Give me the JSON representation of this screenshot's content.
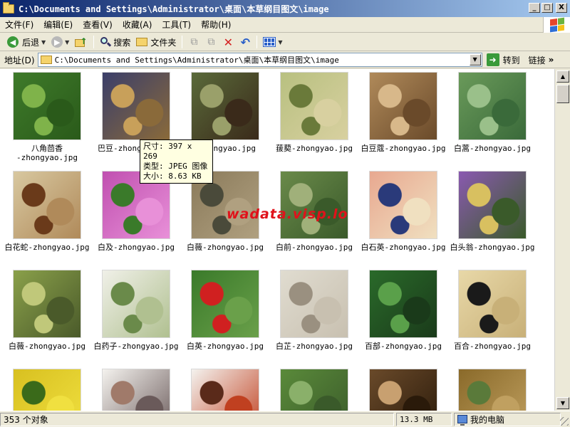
{
  "window": {
    "title": "C:\\Documents and Settings\\Administrator\\桌面\\本草纲目图文\\image",
    "buttons": {
      "minimize": "_",
      "maximize": "□",
      "close": "X"
    }
  },
  "menu": [
    "文件(F)",
    "编辑(E)",
    "查看(V)",
    "收藏(A)",
    "工具(T)",
    "帮助(H)"
  ],
  "toolbar": {
    "back": "后退",
    "search": "搜索",
    "folders": "文件夹"
  },
  "address": {
    "label": "地址(D)",
    "path": "C:\\Documents and Settings\\Administrator\\桌面\\本草纲目图文\\image",
    "go": "转到",
    "links": "链接"
  },
  "files": [
    {
      "name": "八角茴香\n-zhongyao.jpg",
      "colors": [
        "#3e7a2a",
        "#7fb34a",
        "#2a5a1a"
      ]
    },
    {
      "name": "巴豆-zhongyao.jpg",
      "colors": [
        "#3a3e6a",
        "#c8a05a",
        "#8a6a3a"
      ]
    },
    {
      "name": "-zhongyao.jpg",
      "colors": [
        "#5a6a3a",
        "#9aa06a",
        "#3a2a1a"
      ]
    },
    {
      "name": "菝葜-zhongyao.jpg",
      "colors": [
        "#b8c080",
        "#6a7a3a",
        "#d8d0a0"
      ]
    },
    {
      "name": "白豆蔻-zhongyao.jpg",
      "colors": [
        "#b08a5a",
        "#d8b88a",
        "#6a4a2a"
      ]
    },
    {
      "name": "白蒿-zhongyao.jpg",
      "colors": [
        "#6a9a5a",
        "#9ac08a",
        "#3a6a3a"
      ]
    },
    {
      "name": "白花蛇-zhongyao.jpg",
      "colors": [
        "#d8c8a0",
        "#6a3a1a",
        "#b08a5a"
      ]
    },
    {
      "name": "白及-zhongyao.jpg",
      "colors": [
        "#c050b0",
        "#3a7a2a",
        "#e890d8"
      ]
    },
    {
      "name": "白薇-zhongyao.jpg",
      "colors": [
        "#8a7a5a",
        "#4a4a3a",
        "#b0a080"
      ]
    },
    {
      "name": "白前-zhongyao.jpg",
      "colors": [
        "#6a8a4a",
        "#a0b07a",
        "#3a5a2a"
      ]
    },
    {
      "name": "白石英-zhongyao.jpg",
      "colors": [
        "#e8a890",
        "#2a3a7a",
        "#f0e0c0"
      ]
    },
    {
      "name": "白头翁-zhongyao.jpg",
      "colors": [
        "#8a5ab0",
        "#d8c060",
        "#3a5a2a"
      ]
    },
    {
      "name": "白薇-zhongyao.jpg",
      "colors": [
        "#8aa04a",
        "#c0c87a",
        "#4a5a2a"
      ]
    },
    {
      "name": "白药子-zhongyao.jpg",
      "colors": [
        "#f0f0e8",
        "#6a8a4a",
        "#b0c090"
      ]
    },
    {
      "name": "白英-zhongyao.jpg",
      "colors": [
        "#3a7a2a",
        "#d02020",
        "#6aa04a"
      ]
    },
    {
      "name": "白芷-zhongyao.jpg",
      "colors": [
        "#e0dcd0",
        "#9a9080",
        "#c8c0b0"
      ]
    },
    {
      "name": "百部-zhongyao.jpg",
      "colors": [
        "#2a6a2a",
        "#5aa04a",
        "#1a3a1a"
      ]
    },
    {
      "name": "百合-zhongyao.jpg",
      "colors": [
        "#e8d8a8",
        "#1a1a1a",
        "#c8b078"
      ]
    },
    {
      "name": "",
      "colors": [
        "#d8c020",
        "#3a6a1a",
        "#f0e040"
      ]
    },
    {
      "name": "",
      "colors": [
        "#f4f2ee",
        "#a07a6a",
        "#6a5a5a"
      ]
    },
    {
      "name": "",
      "colors": [
        "#f4f2ee",
        "#5a2a1a",
        "#c04020"
      ]
    },
    {
      "name": "",
      "colors": [
        "#5a8a3a",
        "#8ab06a",
        "#3a5a2a"
      ]
    },
    {
      "name": "",
      "colors": [
        "#6a4a2a",
        "#c8a070",
        "#2a1a0a"
      ]
    },
    {
      "name": "",
      "colors": [
        "#8a6a2a",
        "#5a7a3a",
        "#c0a060"
      ]
    }
  ],
  "tooltip": {
    "line1": "尺寸: 397 x 269",
    "line2": "类型: JPEG 图像",
    "line3": "大小: 8.63 KB"
  },
  "watermark": "wadata.visp.lo",
  "status": {
    "objects": "353 个对象",
    "size": "13.3 MB",
    "location": "我的电脑"
  }
}
